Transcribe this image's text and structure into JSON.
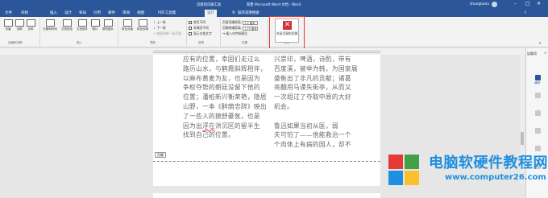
{
  "window": {
    "title": "新建 Microsoft Word 文档 - Word",
    "contextual_title": "页眉和页脚工具",
    "user": "zhangtaolu"
  },
  "tabs": [
    "文件",
    "开始",
    "插入",
    "设计",
    "布局",
    "引用",
    "邮件",
    "审阅",
    "视图",
    "PDF工具集",
    "设计",
    "操作说明搜索"
  ],
  "ribbon": {
    "groups": {
      "header_footer": "页眉和页脚",
      "insert": "插入",
      "navigation": "导航",
      "options": "选项",
      "position": "位置",
      "close": "关闭"
    },
    "buttons": {
      "header": "页眉",
      "footer": "页脚",
      "page_number": "页码",
      "date_time": "日期和时间",
      "doc_info": "文档信息",
      "doc_parts": "文档部件",
      "picture": "图片",
      "online_picture": "联机图片",
      "goto_header": "转至页眉",
      "goto_footer": "转至页脚",
      "previous": "上一条",
      "next": "下一条",
      "link_previous": "链接到前一条页眉",
      "close_header_footer": "关闭页眉和页脚"
    },
    "options": {
      "first_page": "首页不同",
      "odd_even": "奇偶页不同",
      "show_text": "显示文档文字"
    },
    "position": {
      "header_top_label": "页眉顶端距离:",
      "header_top_value": "1.5 厘米",
      "footer_bottom_label": "页脚底端距离:",
      "footer_bottom_value": "1.75 厘米",
      "insert_tab": "插入对齐制表位"
    }
  },
  "document": {
    "col1": [
      "应有的位置，幸固们走过么",
      "路历山水，与鹤霞斜辉相伴，",
      "以麻布黄麦为友，也是因为",
      "争权夺势的朝廷没留下他的",
      "位置；潘柏新兴衡荣艳，隐居",
      "山野，一本《醉荫忠辞》映出",
      "了一些人的撩舒豪氛，也是",
      "因为出浮在洪沉区的留半生",
      "找到自己的位置。"
    ],
    "col1_wavy_line": 7,
    "col1_wavy_start": 3,
    "col1_wavy_end": 5,
    "col2": [
      "兴崇印，啤酒，诗酌，带有",
      "百度溪，被举为韩，为国家展",
      "盛衡出了非凡的贡献；诸葛",
      "亮翻用马谡失街亭，从而又",
      "一次组过了夺取中原的大好",
      "机会。",
      "",
      "鲁迅如果当初从医，弱",
      "夫可怕了——他能救治一个",
      "个肉体上有病的国人，却不"
    ],
    "footer_tag": "页脚"
  },
  "navigation_pane": {
    "title": "加载项",
    "items": [
      "编写",
      "",
      "",
      "",
      "",
      ""
    ]
  },
  "watermark": {
    "title": "电脑软硬件教程网",
    "url": "www.computer26.com"
  },
  "colors": {
    "accent": "#2b579a",
    "highlight": "#e53935",
    "watermark": "#1f8fe0"
  }
}
